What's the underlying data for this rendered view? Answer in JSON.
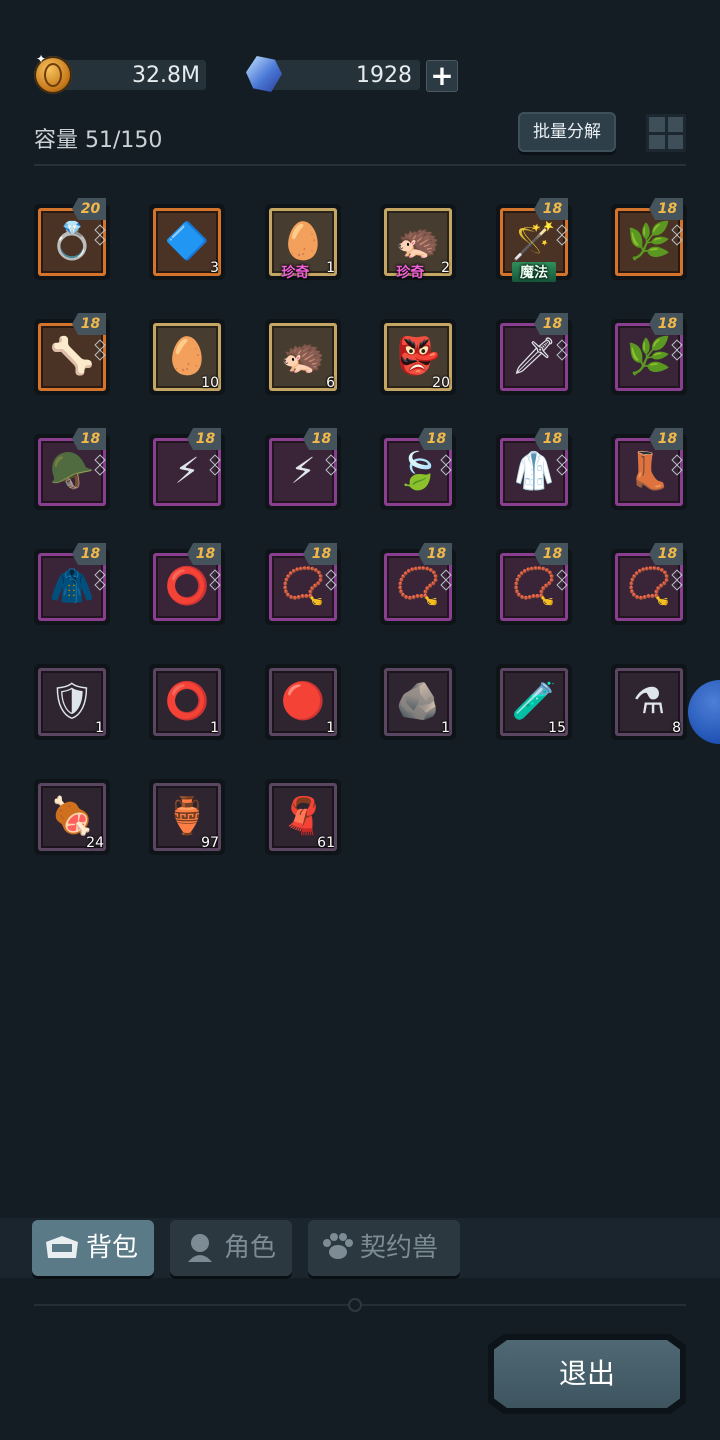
{
  "currency": {
    "gold": "32.8M",
    "gems": "1928",
    "gold_icon": "gold-coin-icon",
    "gem_icon": "blue-crystal-icon",
    "add_icon": "plus-icon"
  },
  "capacity_label": "容量 51/150",
  "batch_button": "批量分解",
  "grid_view_icon": "grid-view-icon",
  "items": [
    {
      "icon": "ring-icon",
      "art": "💍",
      "rarity": "orange",
      "level": "20",
      "count": "",
      "tag": ""
    },
    {
      "icon": "purple-crystal-icon",
      "art": "🔷",
      "rarity": "orange",
      "level": "",
      "count": "3",
      "tag": ""
    },
    {
      "icon": "egg-icon",
      "art": "🥚",
      "rarity": "gold",
      "level": "",
      "count": "1",
      "tag": "珍奇"
    },
    {
      "icon": "beast-egg-icon",
      "art": "🦔",
      "rarity": "gold",
      "level": "",
      "count": "2",
      "tag": "珍奇"
    },
    {
      "icon": "staff-icon",
      "art": "🪄",
      "rarity": "orange",
      "level": "18",
      "count": "",
      "tag": "魔法"
    },
    {
      "icon": "thorn-armor-icon",
      "art": "🌿",
      "rarity": "orange",
      "level": "18",
      "count": "",
      "tag": ""
    },
    {
      "icon": "gauntlet-icon",
      "art": "🦴",
      "rarity": "orange",
      "level": "18",
      "count": "",
      "tag": ""
    },
    {
      "icon": "egg-icon",
      "art": "🥚",
      "rarity": "gold",
      "level": "",
      "count": "10",
      "tag": ""
    },
    {
      "icon": "beast-egg-icon",
      "art": "🦔",
      "rarity": "gold",
      "level": "",
      "count": "6",
      "tag": ""
    },
    {
      "icon": "mask-icon",
      "art": "👺",
      "rarity": "gold",
      "level": "",
      "count": "20",
      "tag": ""
    },
    {
      "icon": "sword-icon",
      "art": "🗡",
      "rarity": "purple",
      "level": "18",
      "count": "",
      "tag": ""
    },
    {
      "icon": "thorn-armor-icon",
      "art": "🌿",
      "rarity": "purple",
      "level": "18",
      "count": "",
      "tag": ""
    },
    {
      "icon": "thorn-helmet-icon",
      "art": "🪖",
      "rarity": "purple",
      "level": "18",
      "count": "",
      "tag": ""
    },
    {
      "icon": "lightning-wand-icon",
      "art": "⚡",
      "rarity": "purple",
      "level": "18",
      "count": "",
      "tag": ""
    },
    {
      "icon": "lightning-wand-icon",
      "art": "⚡",
      "rarity": "purple",
      "level": "18",
      "count": "",
      "tag": ""
    },
    {
      "icon": "leaf-gloves-icon",
      "art": "🍃",
      "rarity": "purple",
      "level": "18",
      "count": "",
      "tag": ""
    },
    {
      "icon": "green-robe-icon",
      "art": "🥼",
      "rarity": "purple",
      "level": "18",
      "count": "",
      "tag": ""
    },
    {
      "icon": "boots-icon",
      "art": "👢",
      "rarity": "purple",
      "level": "18",
      "count": "",
      "tag": ""
    },
    {
      "icon": "red-cloak-icon",
      "art": "🧥",
      "rarity": "purple",
      "level": "18",
      "count": "",
      "tag": ""
    },
    {
      "icon": "thorn-ring-icon",
      "art": "⭕",
      "rarity": "purple",
      "level": "18",
      "count": "",
      "tag": ""
    },
    {
      "icon": "necklace-icon",
      "art": "📿",
      "rarity": "purple",
      "level": "18",
      "count": "",
      "tag": ""
    },
    {
      "icon": "necklace-icon",
      "art": "📿",
      "rarity": "purple",
      "level": "18",
      "count": "",
      "tag": ""
    },
    {
      "icon": "necklace-icon",
      "art": "📿",
      "rarity": "purple",
      "level": "18",
      "count": "",
      "tag": ""
    },
    {
      "icon": "necklace-icon",
      "art": "📿",
      "rarity": "purple",
      "level": "18",
      "count": "",
      "tag": ""
    },
    {
      "icon": "spiked-helmet-icon",
      "art": "🛡",
      "rarity": "slate",
      "level": "",
      "count": "1",
      "tag": ""
    },
    {
      "icon": "iron-collar-icon",
      "art": "⭕",
      "rarity": "slate",
      "level": "",
      "count": "1",
      "tag": ""
    },
    {
      "icon": "red-ore-icon",
      "art": "🔴",
      "rarity": "slate",
      "level": "",
      "count": "1",
      "tag": ""
    },
    {
      "icon": "dark-ore-icon",
      "art": "🪨",
      "rarity": "slate",
      "level": "",
      "count": "1",
      "tag": ""
    },
    {
      "icon": "potion-icon",
      "art": "🧪",
      "rarity": "slate",
      "level": "",
      "count": "15",
      "tag": ""
    },
    {
      "icon": "blue-potion-icon",
      "art": "⚗",
      "rarity": "slate",
      "level": "",
      "count": "8",
      "tag": ""
    },
    {
      "icon": "meat-icon",
      "art": "🍖",
      "rarity": "slate",
      "level": "",
      "count": "24",
      "tag": ""
    },
    {
      "icon": "red-potion-icon",
      "art": "🏺",
      "rarity": "slate",
      "level": "",
      "count": "97",
      "tag": ""
    },
    {
      "icon": "blue-cloth-icon",
      "art": "🧣",
      "rarity": "slate",
      "level": "",
      "count": "61",
      "tag": ""
    }
  ],
  "tabs": [
    {
      "label": "背包",
      "icon": "backpack-icon",
      "active": true
    },
    {
      "label": "角色",
      "icon": "character-icon",
      "active": false
    },
    {
      "label": "契约兽",
      "icon": "paw-icon",
      "active": false
    }
  ],
  "exit_button": "退出",
  "floating_ball_icon": "floating-assist-ball-icon"
}
